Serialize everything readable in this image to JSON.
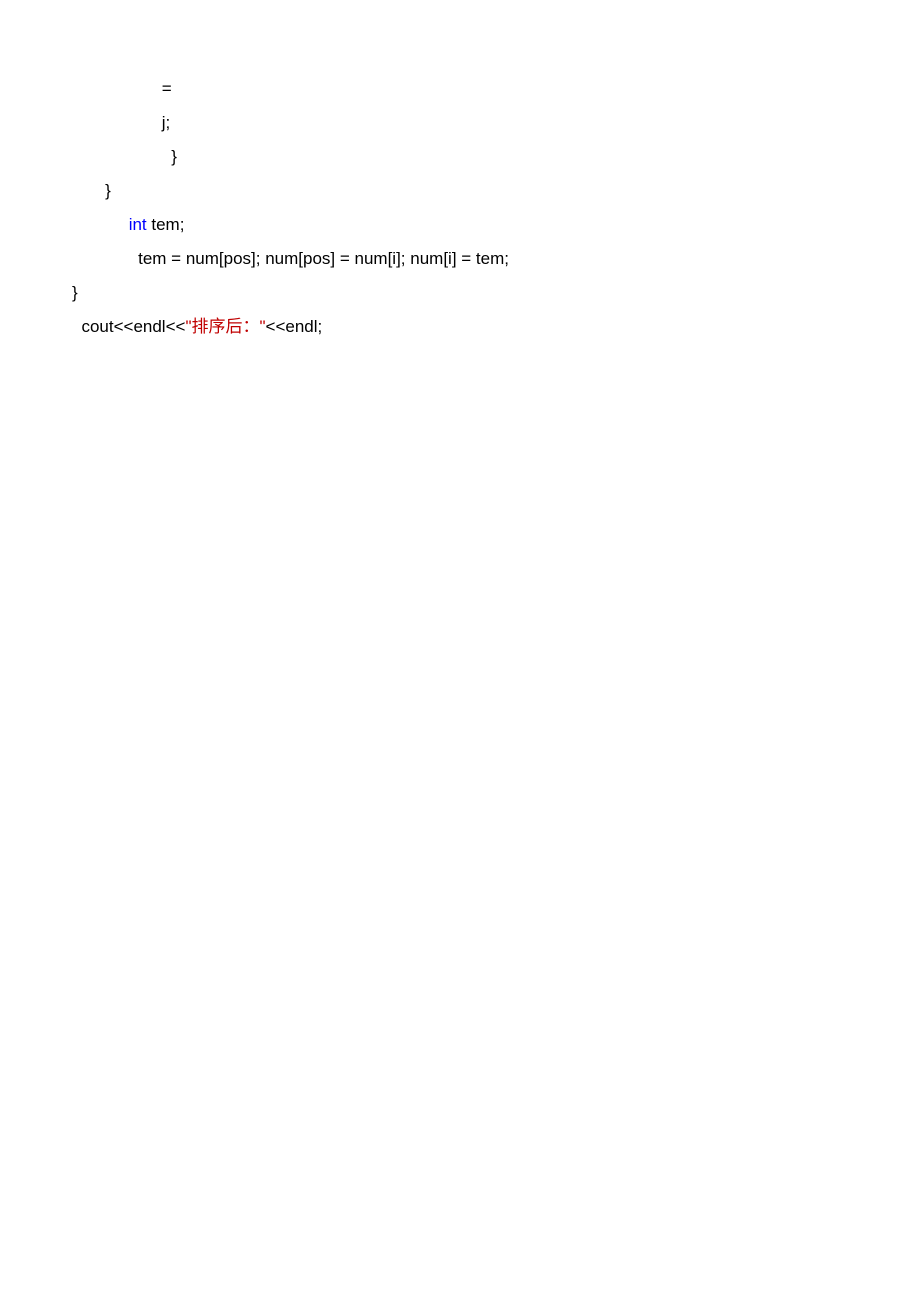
{
  "code": {
    "line1": "= ",
    "line2": "j;",
    "line3": " }",
    "line4": "}",
    "line5_keyword": "int",
    "line5_rest": " tem;",
    "line6": "tem = num[pos]; num[pos] = num[i]; num[i] = tem;",
    "line7": "}",
    "line8_prefix": "cout<<endl<<",
    "line8_quote_open": "\"",
    "line8_string_cn": "排序后：",
    "line8_quote_close": "\"",
    "line8_suffix": "<<endl;"
  }
}
